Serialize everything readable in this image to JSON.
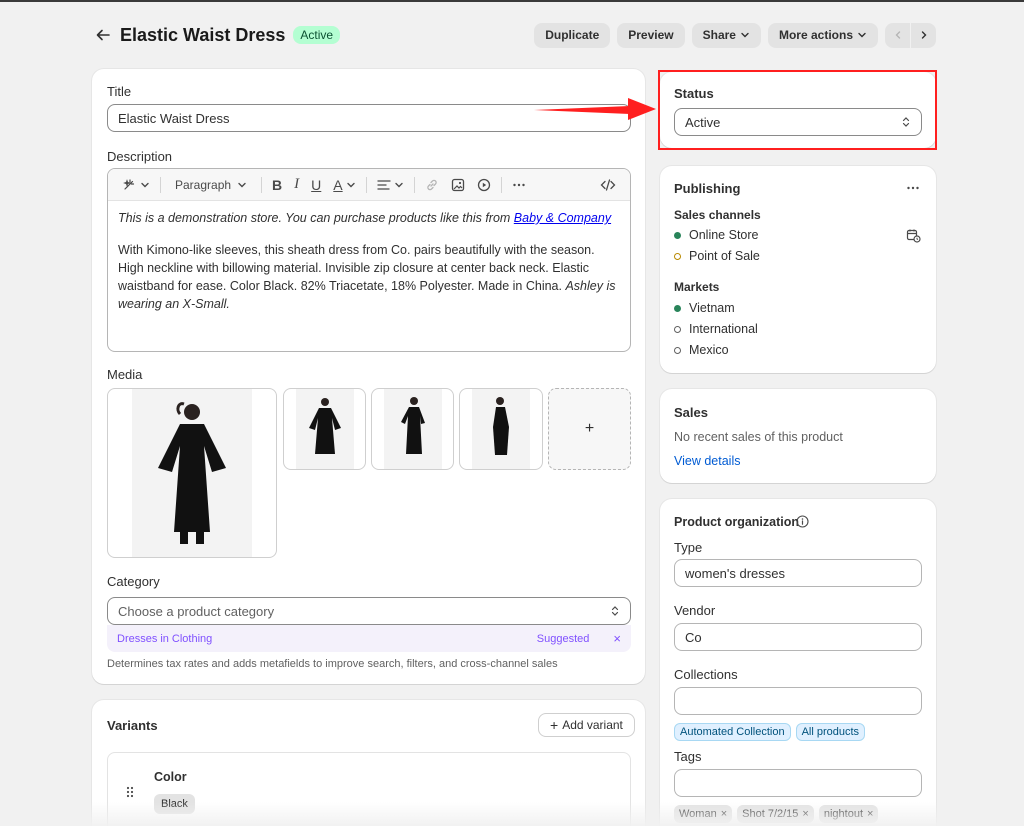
{
  "header": {
    "title": "Elastic Waist Dress",
    "status_badge": "Active",
    "buttons": {
      "duplicate": "Duplicate",
      "preview": "Preview",
      "share": "Share",
      "more": "More actions"
    }
  },
  "main": {
    "title_label": "Title",
    "title_value": "Elastic Waist Dress",
    "description_label": "Description",
    "toolbar": {
      "paragraph": "Paragraph"
    },
    "description": {
      "p1_text": "This is a demonstration store. You can purchase products like this from ",
      "p1_link": "Baby & Company",
      "p2_text": "With Kimono-like sleeves, this sheath dress from Co. pairs beautifully with the season. High neckline with billowing material. Invisible zip closure at center back neck. Elastic waistband for ease. Color Black. 82% Triacetate, 18% Polyester. Made in China. ",
      "p2_italic": "Ashley is wearing an X-Small."
    },
    "media_label": "Media",
    "media_add": "+",
    "category_label": "Category",
    "category_placeholder": "Choose a product category",
    "suggestion": {
      "category": "Dresses",
      "in": "in",
      "parent": "Clothing",
      "tag": "Suggested",
      "dismiss": "×"
    },
    "category_help": "Determines tax rates and adds metafields to improve search, filters, and cross-channel sales"
  },
  "variants": {
    "title": "Variants",
    "add_variant": "Add variant",
    "option_name": "Color",
    "option_value": "Black"
  },
  "status_card": {
    "label": "Status",
    "value": "Active"
  },
  "publishing": {
    "title": "Publishing",
    "sales_channels_label": "Sales channels",
    "channels": [
      {
        "name": "Online Store",
        "color": "#29845a"
      },
      {
        "name": "Point of Sale",
        "color": "#b98900"
      }
    ],
    "markets_label": "Markets",
    "markets": [
      {
        "name": "Vietnam",
        "color": "#29845a"
      },
      {
        "name": "International",
        "color": "#616161"
      },
      {
        "name": "Mexico",
        "color": "#616161"
      }
    ]
  },
  "sales": {
    "title": "Sales",
    "empty_text": "No recent sales of this product",
    "view_details": "View details"
  },
  "organization": {
    "title": "Product organization",
    "type_label": "Type",
    "type_value": "women's dresses",
    "vendor_label": "Vendor",
    "vendor_value": "Co",
    "collections_label": "Collections",
    "collections": [
      "Automated Collection",
      "All products"
    ],
    "tags_label": "Tags",
    "tags": [
      "Woman",
      "Shot 7/2/15",
      "nightout"
    ]
  },
  "colors": {
    "accent": "#005bd3",
    "annotation": "#ff1f1f",
    "badge_bg": "#b4fed2"
  }
}
